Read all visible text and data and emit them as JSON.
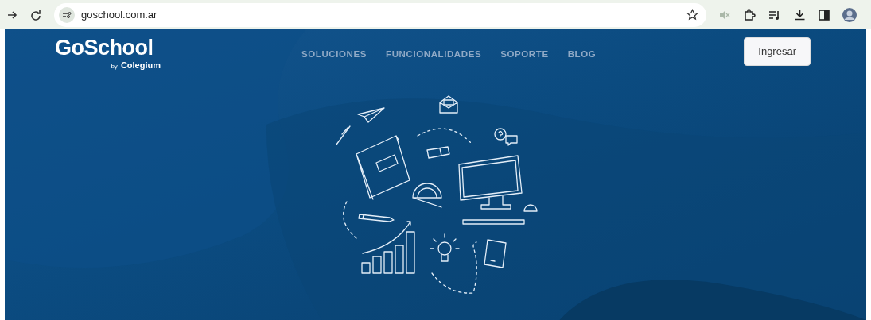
{
  "browser": {
    "url": "goschool.com.ar"
  },
  "header": {
    "logo_title": "GoSchool",
    "logo_by": "by",
    "logo_brand": "Colegium",
    "nav": [
      {
        "label": "SOLUCIONES"
      },
      {
        "label": "FUNCIONALIDADES"
      },
      {
        "label": "SOPORTE"
      },
      {
        "label": "BLOG"
      }
    ],
    "login_button": "Ingresar"
  }
}
